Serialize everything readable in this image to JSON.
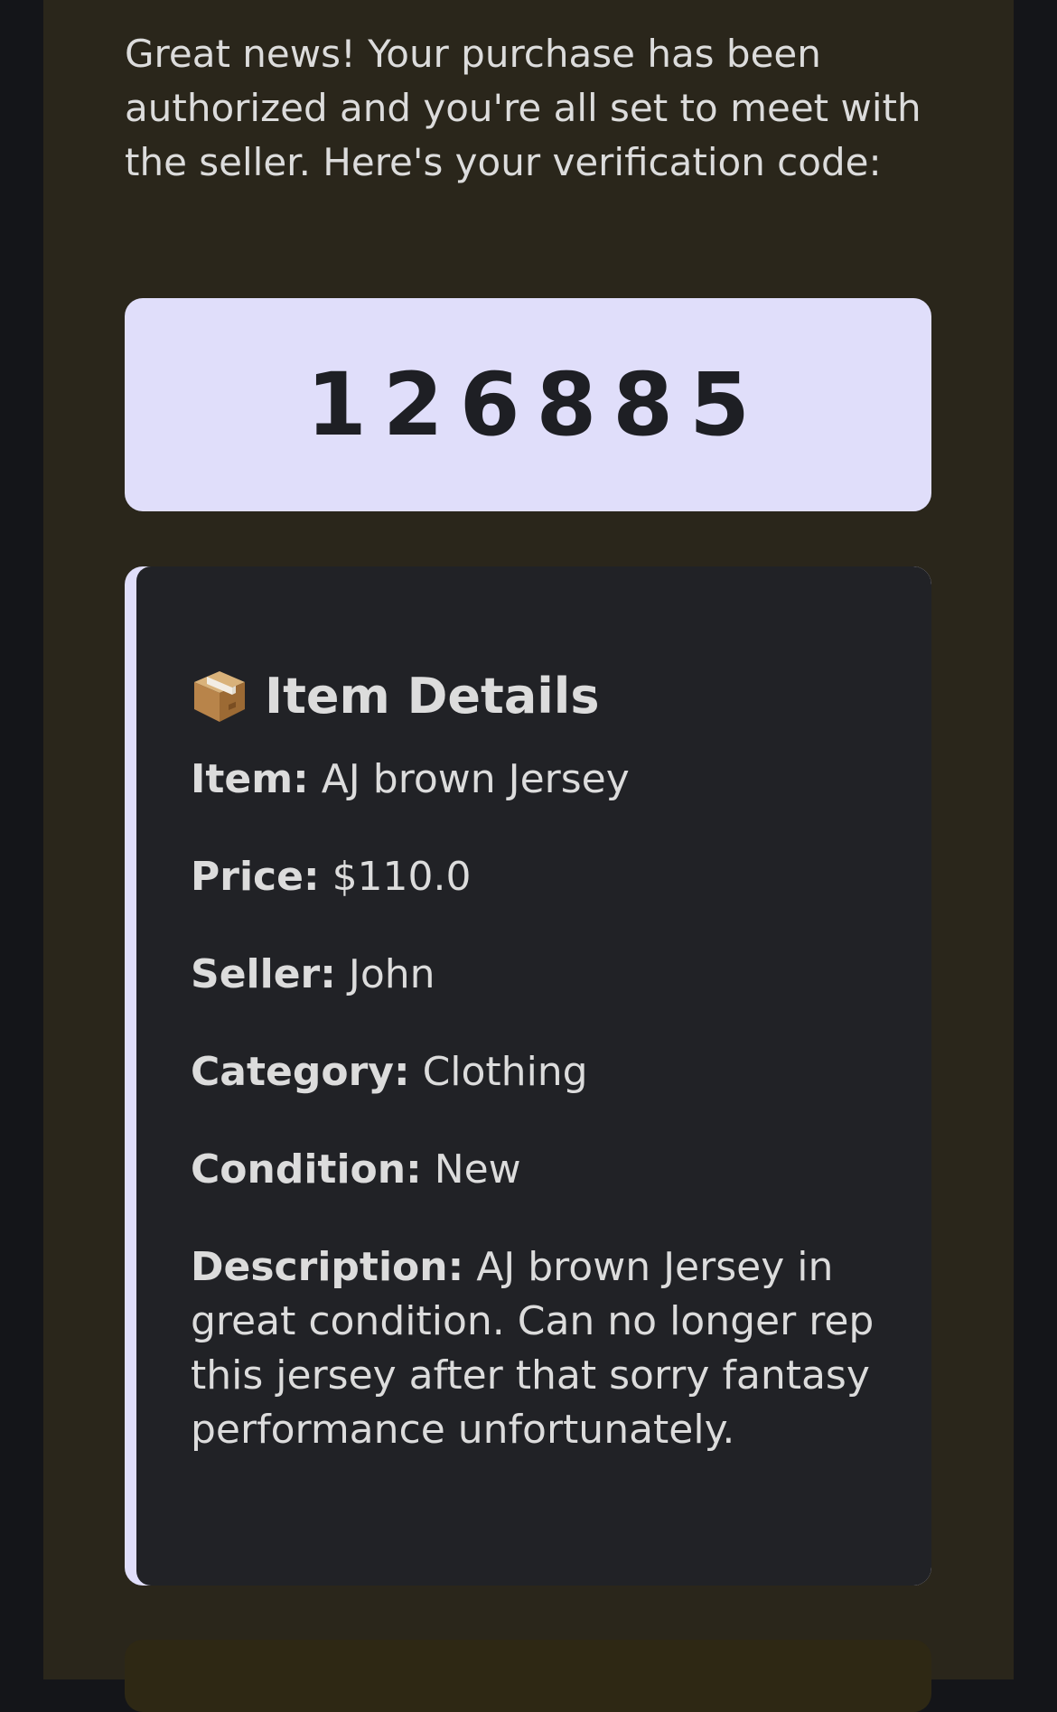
{
  "message": {
    "intro": "Great news! Your purchase has been authorized and you're all set to meet with the seller. Here's your verification code:"
  },
  "verification": {
    "code": "126885"
  },
  "details": {
    "icon": "package-icon",
    "title": "Item Details",
    "rows": [
      {
        "label": "Item:",
        "value": "AJ brown Jersey"
      },
      {
        "label": "Price:",
        "value": "$110.0"
      },
      {
        "label": "Seller:",
        "value": "John"
      },
      {
        "label": "Category:",
        "value": "Clothing"
      },
      {
        "label": "Condition:",
        "value": "New"
      },
      {
        "label": "Description:",
        "value": "AJ brown Jersey in great condition. Can no longer rep this jersey after that sorry fantasy performance unfortunately."
      }
    ]
  },
  "colors": {
    "page_bg": "#141519",
    "email_bg": "#2a261b",
    "code_bg": "#e0defa",
    "card_bg": "#212226",
    "text": "#dcdcdc"
  }
}
